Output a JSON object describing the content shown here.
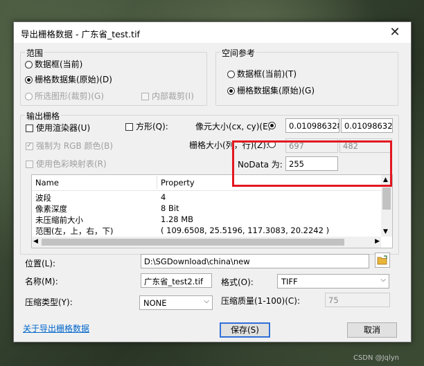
{
  "dialog": {
    "title": "导出栅格数据 - 广东省_test.tif",
    "close_label": "✕"
  },
  "extent": {
    "group_label": "范围",
    "opt_data_frame": "数据框(当前)",
    "opt_raster_dataset": "栅格数据集(原始)(D)",
    "opt_selected_graphics": "所选图形(裁剪)(G)",
    "chk_inner_clip": "内部裁剪(I)"
  },
  "spatial_ref": {
    "group_label": "空间参考",
    "opt_data_frame": "数据框(当前)(T)",
    "opt_raster_dataset": "栅格数据集(原始)(G)"
  },
  "output_raster": {
    "group_label": "输出栅格",
    "chk_use_renderer": "使用渲染器(U)",
    "chk_square": "方形(Q):",
    "cell_size_label": "像元大小(cx, cy)(E):",
    "cell_size_x": "0.01098632812",
    "cell_size_y": "0.01098632812",
    "chk_force_rgb": "强制为 RGB 颜色(B)",
    "raster_size_label": "栅格大小(列，行)(Z):",
    "cols": "697",
    "rows": "482",
    "chk_use_colormap": "使用色彩映射表(R)",
    "nodata_label": "NoData 为:",
    "nodata_value": "255"
  },
  "properties": {
    "headers": [
      "Name",
      "Property"
    ],
    "rows": [
      [
        "波段",
        "4"
      ],
      [
        "像素深度",
        "8 Bit"
      ],
      [
        "未压缩前大小",
        "1.28 MB"
      ],
      [
        "范围(左，上，右，下)",
        "( 109.6508, 25.5196, 117.3083, 20.2242 )"
      ]
    ]
  },
  "form": {
    "location_label": "位置(L):",
    "location_value": "D:\\SGDownload\\china\\new",
    "name_label": "名称(M):",
    "name_value": "广东省_test2.tif",
    "format_label": "格式(O):",
    "format_value": "TIFF",
    "compression_label": "压缩类型(Y):",
    "compression_value": "NONE",
    "quality_label": "压缩质量(1-100)(C):",
    "quality_value": "75"
  },
  "footer": {
    "about_link": "关于导出栅格数据",
    "save_label": "保存(S)",
    "cancel_label": "取消"
  },
  "watermark": "CSDN @Jqlyn"
}
